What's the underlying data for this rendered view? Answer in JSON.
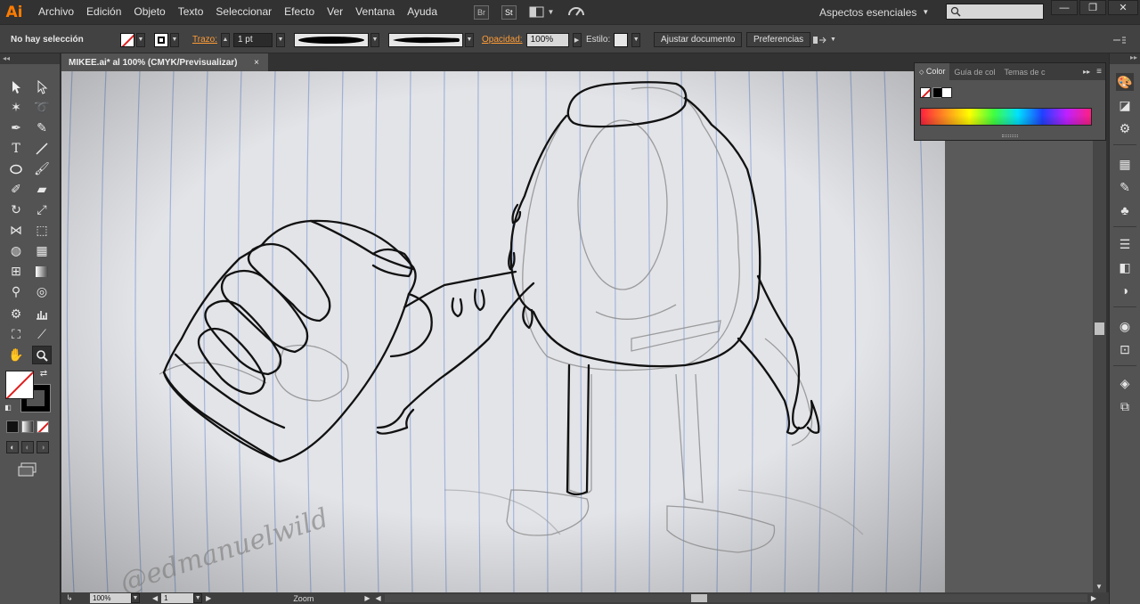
{
  "app": {
    "logo": "Ai"
  },
  "menu": [
    "Archivo",
    "Edición",
    "Objeto",
    "Texto",
    "Seleccionar",
    "Efecto",
    "Ver",
    "Ventana",
    "Ayuda"
  ],
  "menu_icons": {
    "bridge": "Br",
    "stock": "St"
  },
  "workspace": {
    "label": "Aspectos esenciales"
  },
  "control": {
    "selection": "No hay selección",
    "stroke_label": "Trazo:",
    "stroke_value": "1 pt",
    "opacity_label": "Opacidad:",
    "opacity_value": "100%",
    "style_label": "Estilo:",
    "doc_setup": "Ajustar documento",
    "preferences": "Preferencias"
  },
  "document": {
    "tab_title": "MIKEE.ai* al 100% (CMYK/Previsualizar)",
    "tab_close": "×"
  },
  "color_panel": {
    "tabs": [
      "Color",
      "Guía de col",
      "Temas de c"
    ]
  },
  "status": {
    "zoom_value": "100%",
    "artboard_value": "1",
    "tool_label": "Zoom"
  },
  "artwork": {
    "signature": "@edmanuelwild"
  },
  "colors": {
    "accent": "#ff7c00",
    "chrome": "#323232",
    "panel": "#535353",
    "paper": "#e5e6ea"
  }
}
